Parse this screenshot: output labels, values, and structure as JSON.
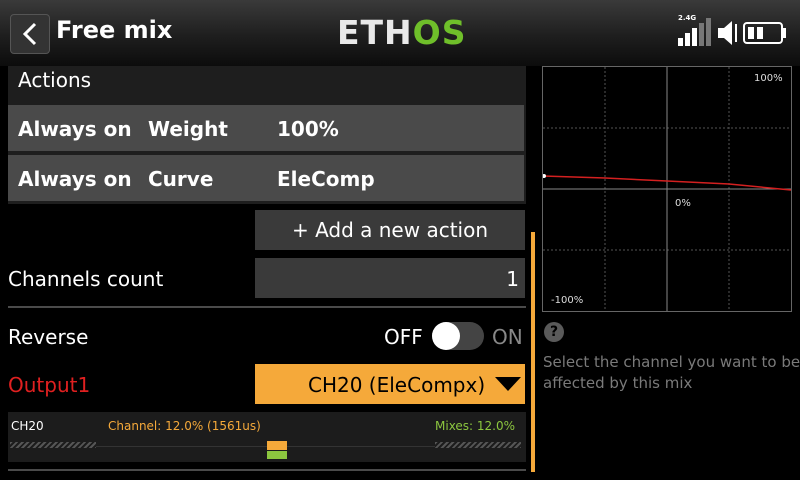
{
  "header": {
    "title": "Free mix",
    "logo_main": "ETH",
    "logo_accent": "OS",
    "rf_label": "2.4G"
  },
  "actions": {
    "title": "Actions",
    "rows": [
      {
        "condition": "Always on",
        "type": "Weight",
        "value": "100%"
      },
      {
        "condition": "Always on",
        "type": "Curve",
        "value": "EleComp"
      }
    ],
    "add_label": "+ Add a new action"
  },
  "channels_count": {
    "label": "Channels count",
    "value": "1"
  },
  "reverse": {
    "label": "Reverse",
    "off_label": "OFF",
    "on_label": "ON",
    "state": "off"
  },
  "output": {
    "label": "Output1",
    "value": "CH20 (EleCompx)"
  },
  "monitor": {
    "channel": "CH20",
    "channel_text": "Channel: 12.0% (1561us)",
    "mixes_text": "Mixes: 12.0%"
  },
  "graph": {
    "top_label": "100%",
    "mid_label": "0%",
    "bottom_label": "-100%"
  },
  "help": {
    "text": "Select the channel you want to be affected by this mix"
  },
  "colors": {
    "accent": "#f5a93a",
    "output_label": "#e02020",
    "mixes": "#8cc63f",
    "curve": "#d42020"
  }
}
